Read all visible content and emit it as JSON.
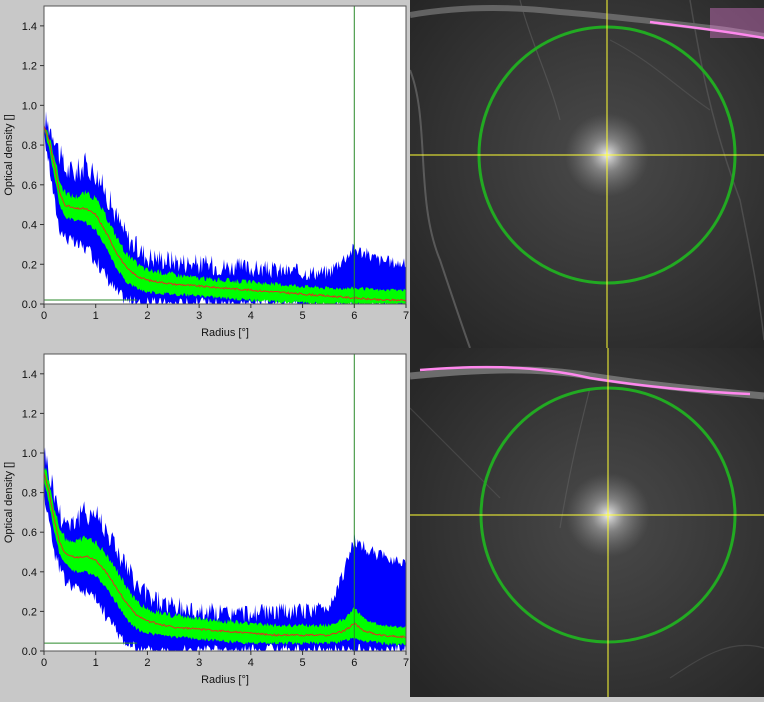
{
  "chart_data": [
    {
      "type": "area",
      "xlabel": "Radius [°]",
      "ylabel": "Optical density []",
      "xlim": [
        0,
        7
      ],
      "ylim": [
        0,
        1.5
      ],
      "xticks": [
        "0",
        "1",
        "2",
        "3",
        "4",
        "5",
        "6",
        "7"
      ],
      "yticks": [
        "0.0",
        "0.2",
        "0.4",
        "0.6",
        "0.8",
        "1.0",
        "1.2",
        "1.4"
      ],
      "grid": false,
      "marker_x": 6,
      "baseline_y": 0.02,
      "colors": {
        "outer_band": "#0000ff",
        "inner_band": "#00ff00",
        "mean": "#e03020",
        "marker": "#2a8a2a"
      },
      "series": [
        {
          "x": [
            0.0,
            0.1,
            0.2,
            0.3,
            0.4,
            0.6,
            0.8,
            1.0,
            1.2,
            1.4,
            1.6,
            1.8,
            2.0,
            2.5,
            3.0,
            3.5,
            4.0,
            4.5,
            5.0,
            5.5,
            6.0,
            6.5,
            7.0
          ],
          "mean": [
            0.9,
            0.82,
            0.7,
            0.56,
            0.5,
            0.48,
            0.48,
            0.45,
            0.36,
            0.26,
            0.18,
            0.14,
            0.12,
            0.1,
            0.09,
            0.08,
            0.07,
            0.06,
            0.05,
            0.04,
            0.03,
            0.02,
            0.02
          ],
          "upper": [
            0.92,
            0.9,
            0.86,
            0.75,
            0.68,
            0.66,
            0.7,
            0.66,
            0.56,
            0.44,
            0.34,
            0.28,
            0.24,
            0.22,
            0.2,
            0.19,
            0.18,
            0.17,
            0.16,
            0.16,
            0.28,
            0.22,
            0.2
          ],
          "lower": [
            0.86,
            0.7,
            0.52,
            0.38,
            0.34,
            0.3,
            0.28,
            0.22,
            0.14,
            0.06,
            0.02,
            0.0,
            0.0,
            0.0,
            0.0,
            0.0,
            0.0,
            0.0,
            0.0,
            0.0,
            0.0,
            0.0,
            0.0
          ],
          "inner_upper": [
            0.9,
            0.84,
            0.75,
            0.62,
            0.56,
            0.54,
            0.56,
            0.53,
            0.44,
            0.34,
            0.25,
            0.2,
            0.17,
            0.15,
            0.13,
            0.12,
            0.11,
            0.1,
            0.09,
            0.08,
            0.08,
            0.07,
            0.07
          ],
          "inner_lower": [
            0.88,
            0.78,
            0.64,
            0.5,
            0.44,
            0.42,
            0.41,
            0.37,
            0.28,
            0.18,
            0.11,
            0.08,
            0.06,
            0.05,
            0.04,
            0.03,
            0.02,
            0.01,
            0.01,
            0.0,
            0.0,
            0.0,
            0.0
          ]
        }
      ]
    },
    {
      "type": "area",
      "xlabel": "Radius [°]",
      "ylabel": "Optical density []",
      "xlim": [
        0,
        7
      ],
      "ylim": [
        0,
        1.5
      ],
      "xticks": [
        "0",
        "1",
        "2",
        "3",
        "4",
        "5",
        "6",
        "7"
      ],
      "yticks": [
        "0.0",
        "0.2",
        "0.4",
        "0.6",
        "0.8",
        "1.0",
        "1.2",
        "1.4"
      ],
      "grid": false,
      "marker_x": 6,
      "baseline_y": 0.04,
      "colors": {
        "outer_band": "#0000ff",
        "inner_band": "#00ff00",
        "mean": "#e03020",
        "marker": "#2a8a2a"
      },
      "series": [
        {
          "x": [
            0.0,
            0.1,
            0.2,
            0.3,
            0.4,
            0.6,
            0.8,
            1.0,
            1.2,
            1.4,
            1.6,
            1.8,
            2.0,
            2.5,
            3.0,
            3.5,
            4.0,
            4.5,
            5.0,
            5.5,
            5.8,
            6.0,
            6.2,
            6.5,
            7.0
          ],
          "mean": [
            0.9,
            0.8,
            0.66,
            0.55,
            0.5,
            0.47,
            0.48,
            0.46,
            0.4,
            0.32,
            0.24,
            0.18,
            0.15,
            0.12,
            0.11,
            0.1,
            0.09,
            0.08,
            0.08,
            0.08,
            0.1,
            0.14,
            0.1,
            0.08,
            0.07
          ],
          "upper": [
            1.02,
            0.9,
            0.8,
            0.7,
            0.66,
            0.66,
            0.7,
            0.7,
            0.62,
            0.52,
            0.42,
            0.32,
            0.28,
            0.22,
            0.2,
            0.19,
            0.19,
            0.2,
            0.2,
            0.22,
            0.4,
            0.56,
            0.52,
            0.48,
            0.45
          ],
          "lower": [
            0.8,
            0.66,
            0.5,
            0.42,
            0.36,
            0.32,
            0.3,
            0.26,
            0.18,
            0.1,
            0.04,
            0.0,
            0.0,
            0.0,
            0.0,
            0.0,
            0.0,
            0.0,
            0.0,
            0.0,
            0.0,
            0.0,
            0.0,
            0.0,
            0.0
          ],
          "inner_upper": [
            0.94,
            0.86,
            0.72,
            0.62,
            0.57,
            0.55,
            0.57,
            0.55,
            0.49,
            0.41,
            0.32,
            0.25,
            0.21,
            0.18,
            0.16,
            0.15,
            0.14,
            0.13,
            0.13,
            0.13,
            0.16,
            0.22,
            0.16,
            0.13,
            0.12
          ],
          "inner_lower": [
            0.86,
            0.74,
            0.6,
            0.49,
            0.44,
            0.4,
            0.4,
            0.38,
            0.32,
            0.24,
            0.16,
            0.11,
            0.09,
            0.07,
            0.06,
            0.05,
            0.04,
            0.04,
            0.04,
            0.04,
            0.05,
            0.07,
            0.05,
            0.04,
            0.03
          ]
        }
      ]
    }
  ],
  "images": [
    {
      "name": "fundus-image-top",
      "crosshair_color": "#ffff33",
      "circle_color": "#22aa22",
      "annotation_color": "#ff88ee"
    },
    {
      "name": "fundus-image-bottom",
      "crosshair_color": "#ffff33",
      "circle_color": "#22aa22",
      "annotation_color": "#ff88ee"
    }
  ]
}
